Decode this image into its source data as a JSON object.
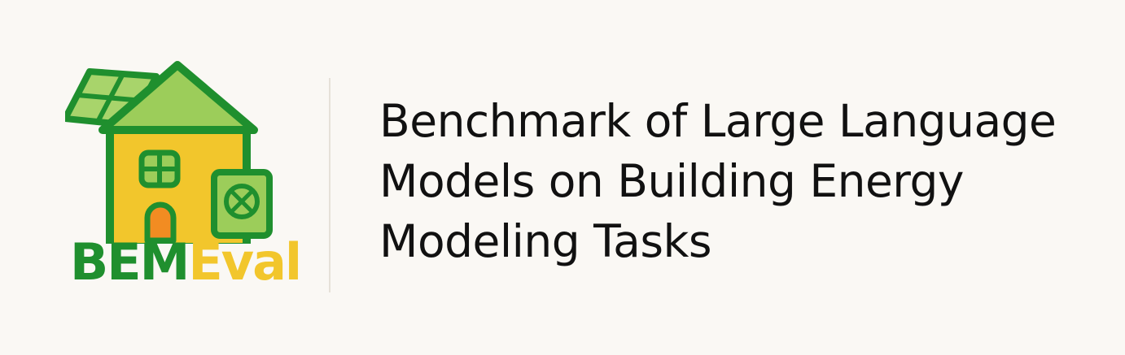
{
  "logo": {
    "wordmark_part1": "BEM",
    "wordmark_part2": "Eval",
    "icons": [
      "house-icon",
      "solar-panel-icon",
      "heat-pump-icon",
      "window-icon",
      "door-icon"
    ]
  },
  "headline": {
    "lines": [
      "Benchmark of Large Language",
      "Models on Building Energy",
      "Modeling Tasks"
    ]
  },
  "colors": {
    "background": "#faf8f4",
    "brand_green": "#1f8f2e",
    "brand_yellow": "#f2c62c",
    "roof_green": "#9ccd5a",
    "panel_green": "#a8d46b",
    "text": "#111111"
  }
}
